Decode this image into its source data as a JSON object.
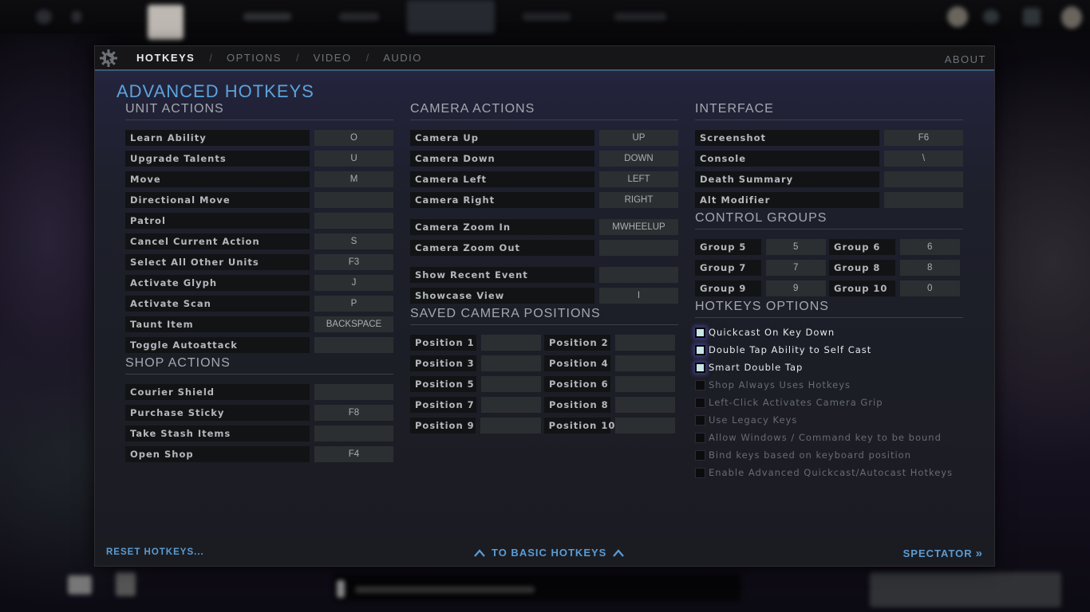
{
  "dialog": {
    "tabs": [
      {
        "label": "HOTKEYS",
        "active": true
      },
      {
        "label": "OPTIONS",
        "active": false
      },
      {
        "label": "VIDEO",
        "active": false
      },
      {
        "label": "AUDIO",
        "active": false
      }
    ],
    "tab_separator": "/",
    "about_label": "ABOUT",
    "page_title": "ADVANCED HOTKEYS"
  },
  "unit_actions": {
    "title": "UNIT ACTIONS",
    "rows": [
      {
        "label": "Learn Ability",
        "key": "O"
      },
      {
        "label": "Upgrade Talents",
        "key": "U"
      },
      {
        "label": "Move",
        "key": "M"
      },
      {
        "label": "Directional Move",
        "key": ""
      },
      {
        "label": "Patrol",
        "key": ""
      },
      {
        "label": "Cancel Current Action",
        "key": "S"
      },
      {
        "label": "Select All Other Units",
        "key": "F3"
      },
      {
        "label": "Activate Glyph",
        "key": "J"
      },
      {
        "label": "Activate Scan",
        "key": "P"
      },
      {
        "label": "Taunt Item",
        "key": "BACKSPACE"
      },
      {
        "label": "Toggle Autoattack",
        "key": ""
      }
    ]
  },
  "shop_actions": {
    "title": "SHOP ACTIONS",
    "rows": [
      {
        "label": "Courier Shield",
        "key": ""
      },
      {
        "label": "Purchase Sticky",
        "key": "F8"
      },
      {
        "label": "Take Stash Items",
        "key": ""
      },
      {
        "label": "Open Shop",
        "key": "F4"
      }
    ]
  },
  "camera_actions": {
    "title": "CAMERA ACTIONS",
    "rows": [
      {
        "label": "Camera Up",
        "key": "UP"
      },
      {
        "label": "Camera Down",
        "key": "DOWN"
      },
      {
        "label": "Camera Left",
        "key": "LEFT"
      },
      {
        "label": "Camera Right",
        "key": "RIGHT"
      },
      {
        "label": "Camera Zoom In",
        "key": "MWHEELUP"
      },
      {
        "label": "Camera Zoom Out",
        "key": ""
      },
      {
        "label": "Show Recent Event",
        "key": ""
      },
      {
        "label": "Showcase View",
        "key": "I"
      }
    ]
  },
  "saved_camera_positions": {
    "title": "SAVED CAMERA POSITIONS",
    "rows": [
      [
        {
          "label": "Position 1",
          "key": ""
        },
        {
          "label": "Position 2",
          "key": ""
        }
      ],
      [
        {
          "label": "Position 3",
          "key": ""
        },
        {
          "label": "Position 4",
          "key": ""
        }
      ],
      [
        {
          "label": "Position 5",
          "key": ""
        },
        {
          "label": "Position 6",
          "key": ""
        }
      ],
      [
        {
          "label": "Position 7",
          "key": ""
        },
        {
          "label": "Position 8",
          "key": ""
        }
      ],
      [
        {
          "label": "Position 9",
          "key": ""
        },
        {
          "label": "Position 10",
          "key": ""
        }
      ]
    ]
  },
  "interface": {
    "title": "INTERFACE",
    "rows": [
      {
        "label": "Screenshot",
        "key": "F6"
      },
      {
        "label": "Console",
        "key": "\\"
      },
      {
        "label": "Death Summary",
        "key": ""
      },
      {
        "label": "Alt Modifier",
        "key": ""
      }
    ]
  },
  "control_groups": {
    "title": "CONTROL GROUPS",
    "rows": [
      [
        {
          "label": "Group 5",
          "key": "5"
        },
        {
          "label": "Group 6",
          "key": "6"
        }
      ],
      [
        {
          "label": "Group 7",
          "key": "7"
        },
        {
          "label": "Group 8",
          "key": "8"
        }
      ],
      [
        {
          "label": "Group 9",
          "key": "9"
        },
        {
          "label": "Group 10",
          "key": "0"
        }
      ]
    ]
  },
  "hotkeys_options": {
    "title": "HOTKEYS OPTIONS",
    "options": [
      {
        "label": "Quickcast On Key Down",
        "checked": true
      },
      {
        "label": "Double Tap Ability to Self Cast",
        "checked": true
      },
      {
        "label": "Smart Double Tap",
        "checked": true
      },
      {
        "label": "Shop Always Uses Hotkeys",
        "checked": false
      },
      {
        "label": "Left-Click Activates Camera Grip",
        "checked": false
      },
      {
        "label": "Use Legacy Keys",
        "checked": false
      },
      {
        "label": "Allow Windows / Command key to be bound",
        "checked": false
      },
      {
        "label": "Bind keys based on keyboard position",
        "checked": false
      },
      {
        "label": "Enable Advanced Quickcast/Autocast Hotkeys",
        "checked": false
      }
    ]
  },
  "footer": {
    "reset_label": "RESET HOTKEYS...",
    "basic_label": "TO BASIC HOTKEYS",
    "spectator_label": "SPECTATOR",
    "spectator_icon": "»"
  },
  "colors": {
    "accent": "#5ca3dc",
    "link": "#5a9cd4",
    "tab_underline": "#3d5a73"
  }
}
